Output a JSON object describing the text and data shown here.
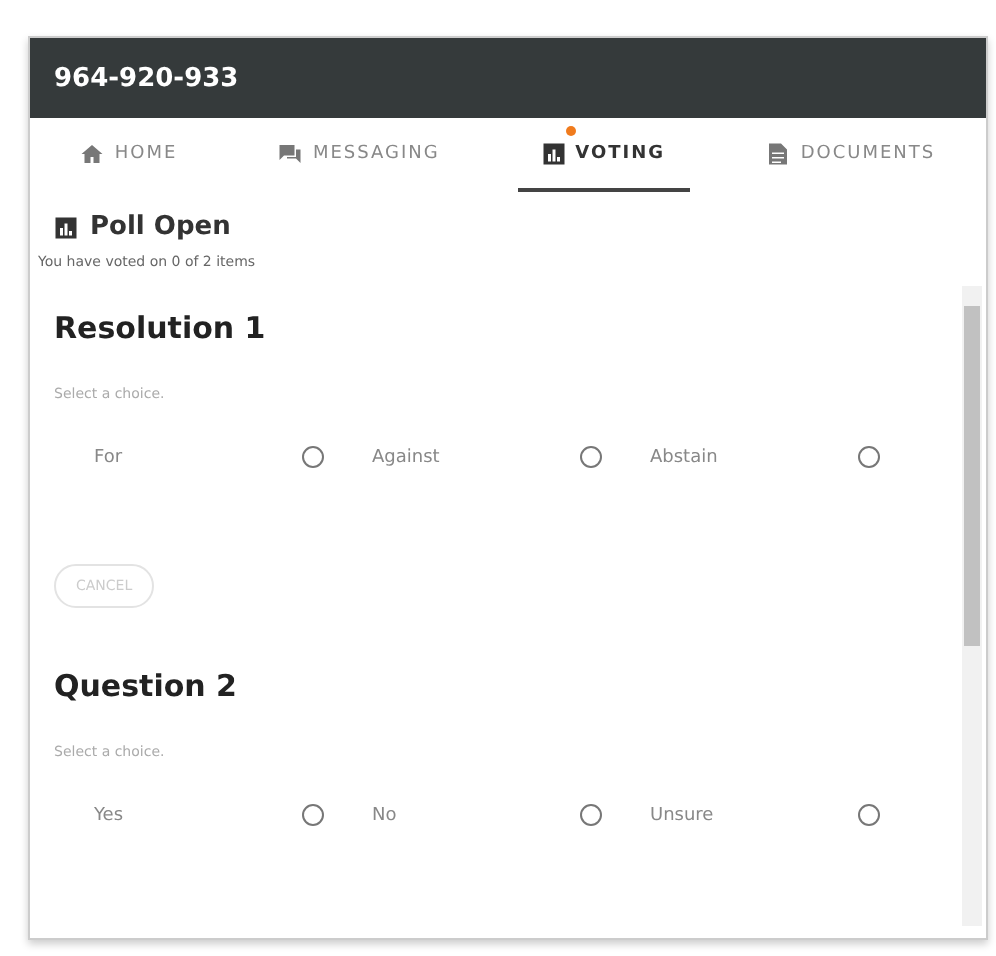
{
  "header": {
    "title": "964-920-933"
  },
  "tabs": [
    {
      "label": "HOME",
      "selected": false,
      "badge": false
    },
    {
      "label": "MESSAGING",
      "selected": false,
      "badge": false
    },
    {
      "label": "VOTING",
      "selected": true,
      "badge": true
    },
    {
      "label": "DOCUMENTS",
      "selected": false,
      "badge": false
    }
  ],
  "poll": {
    "status": "Poll Open",
    "progress": "You have voted on 0 of 2 items"
  },
  "items": [
    {
      "title": "Resolution 1",
      "prompt": "Select a choice.",
      "choices": [
        {
          "label": "For",
          "selected": false
        },
        {
          "label": "Against",
          "selected": false
        },
        {
          "label": "Abstain",
          "selected": false
        }
      ],
      "cancel": "CANCEL"
    },
    {
      "title": "Question 2",
      "prompt": "Select a choice.",
      "choices": [
        {
          "label": "Yes",
          "selected": false
        },
        {
          "label": "No",
          "selected": false
        },
        {
          "label": "Unsure",
          "selected": false
        }
      ]
    }
  ]
}
